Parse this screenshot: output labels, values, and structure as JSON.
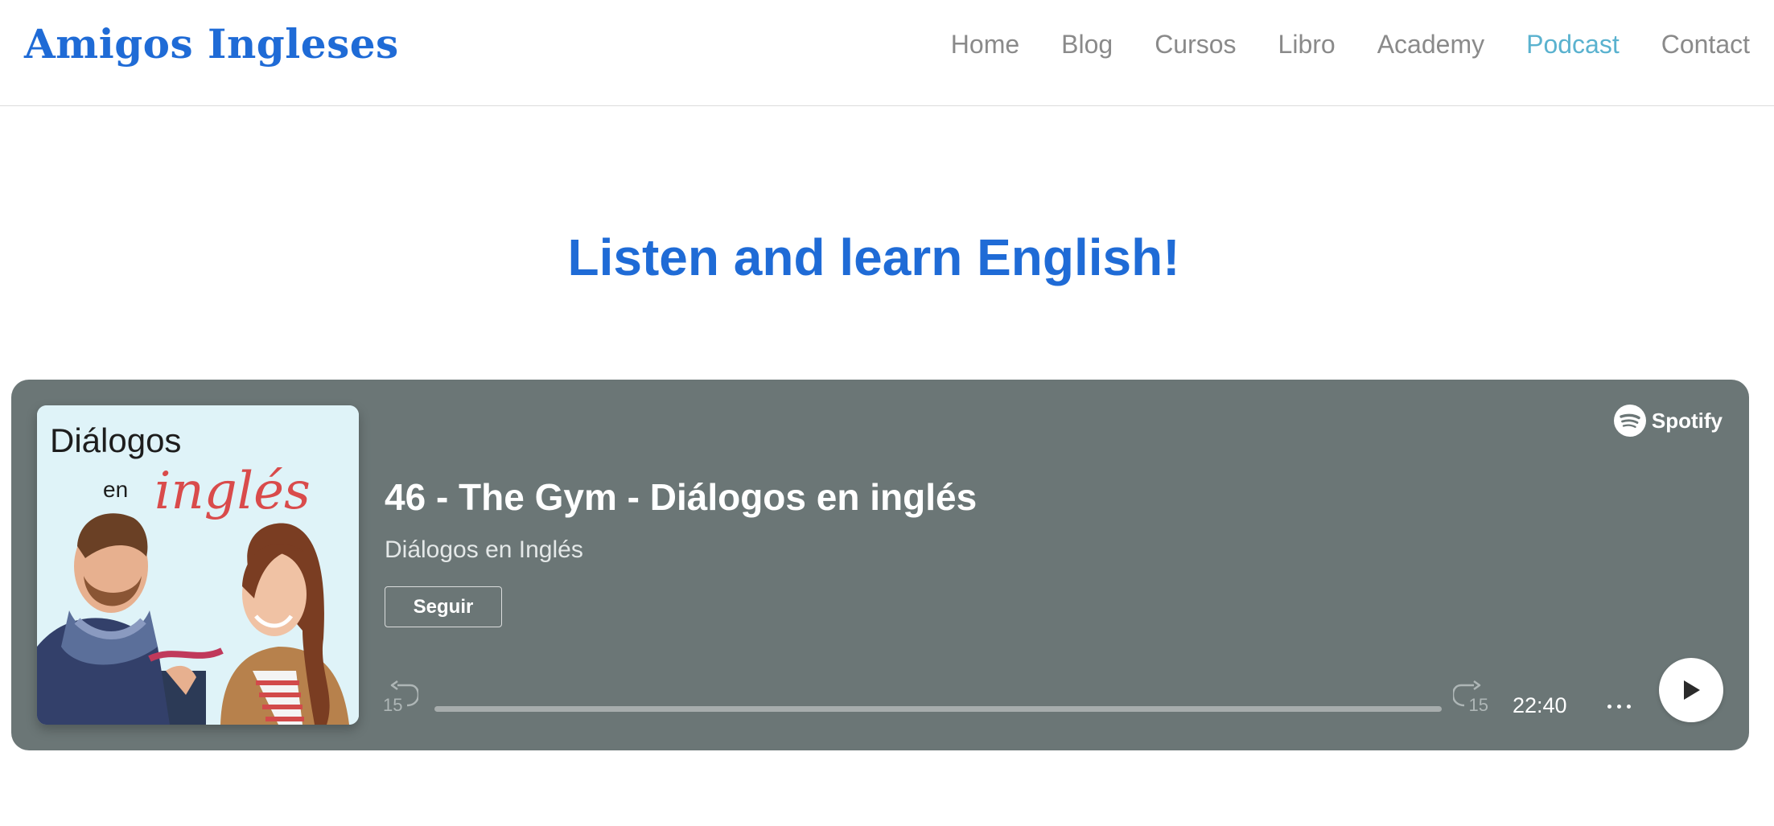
{
  "header": {
    "logo": "Amigos Ingleses",
    "nav": [
      {
        "label": "Home",
        "active": false
      },
      {
        "label": "Blog",
        "active": false
      },
      {
        "label": "Cursos",
        "active": false
      },
      {
        "label": "Libro",
        "active": false
      },
      {
        "label": "Academy",
        "active": false
      },
      {
        "label": "Podcast",
        "active": true
      },
      {
        "label": "Contact",
        "active": false
      }
    ]
  },
  "hero": {
    "title": "Listen and learn English!"
  },
  "player": {
    "brand": "Spotify",
    "cover": {
      "line1": "Diálogos",
      "line2": "en",
      "line3": "inglés"
    },
    "episode_title": "46 - The Gym - Diálogos en inglés",
    "show_name": "Diálogos en Inglés",
    "follow_label": "Seguir",
    "skip_back_label": "15",
    "skip_forward_label": "15",
    "duration": "22:40",
    "progress": 0.0
  },
  "colors": {
    "brand_blue": "#1f6bd6",
    "nav_active": "#5ab2cf",
    "nav_inactive": "#8a8a8a",
    "player_bg": "#6b7676"
  }
}
